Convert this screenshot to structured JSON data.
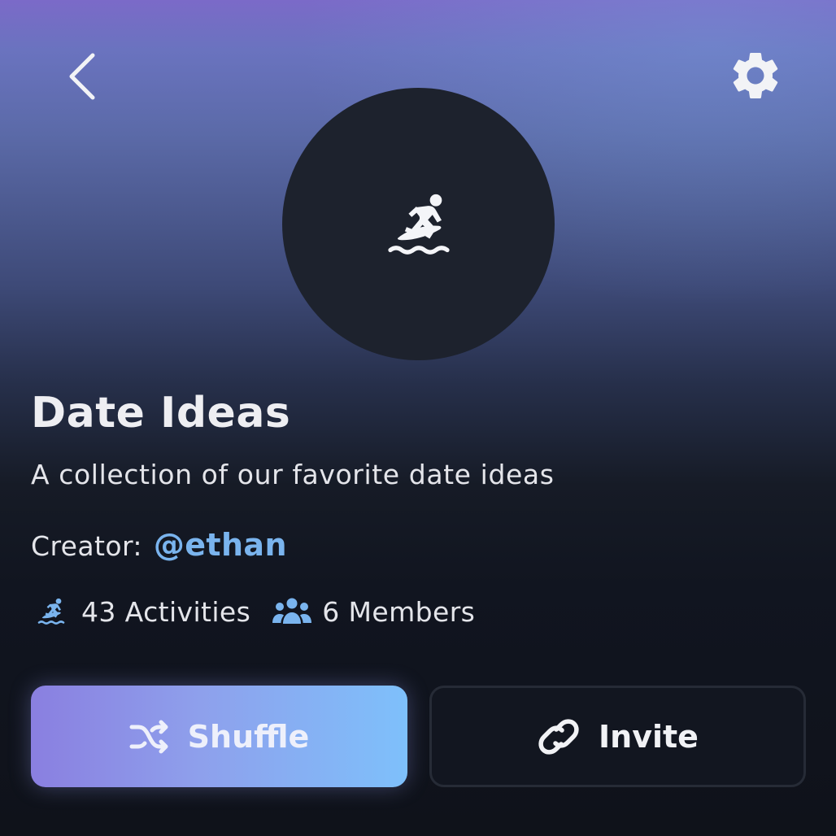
{
  "header": {
    "back_icon": "chevron-left-icon",
    "settings_icon": "gear-icon"
  },
  "collection": {
    "avatar_icon": "surfing-icon",
    "title": "Date Ideas",
    "description": "A collection of our favorite date ideas",
    "creator_label": "Creator:",
    "creator_handle": "@ethan",
    "activities_icon": "surfing-icon",
    "activities": "43 Activities",
    "members_icon": "group-icon",
    "members": "6 Members"
  },
  "actions": {
    "shuffle_label": "Shuffle",
    "shuffle_icon": "shuffle-icon",
    "invite_label": "Invite",
    "invite_icon": "link-icon"
  },
  "colors": {
    "accent_link": "#7ab4ee",
    "shuffle_gradient_start": "#8a7fe0",
    "shuffle_gradient_end": "#7ec0fb",
    "background_dark": "#0f121a"
  }
}
